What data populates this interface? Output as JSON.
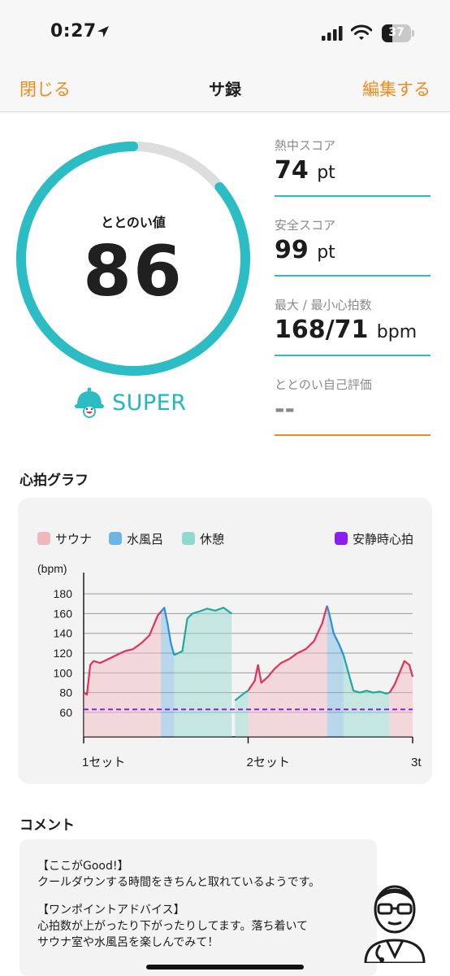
{
  "status_bar": {
    "time": "0:27",
    "battery_level": "37",
    "icons": [
      "location-arrow-icon",
      "cellular-signal-icon",
      "wifi-icon",
      "battery-icon"
    ]
  },
  "nav": {
    "close_label": "閉じる",
    "title": "サ録",
    "edit_label": "編集する",
    "accent_color": "#f08a1c"
  },
  "score": {
    "label": "ととのい値",
    "value": "86",
    "fraction": 0.86,
    "rank": "SUPER",
    "rank_icon": "sauna-hat-icon",
    "ring_color": "#2bbcc4"
  },
  "stats": [
    {
      "label": "熱中スコア",
      "value": "74",
      "unit": "pt"
    },
    {
      "label": "安全スコア",
      "value": "99",
      "unit": "pt"
    },
    {
      "label": "最大 / 最小心拍数",
      "value": "168/71",
      "unit": "bpm"
    },
    {
      "label": "ととのい自己評価",
      "value": "--",
      "unit": ""
    }
  ],
  "graph": {
    "section_title": "心拍グラフ",
    "legend": [
      {
        "label": "サウナ",
        "color": "#f0b8bc"
      },
      {
        "label": "水風呂",
        "color": "#6fb5e3"
      },
      {
        "label": "休憩",
        "color": "#8fd8cf"
      },
      {
        "label": "安静時心拍",
        "color": "#8a1ff0"
      }
    ]
  },
  "chart_data": {
    "type": "line",
    "ylabel": "(bpm)",
    "ylim": [
      50,
      190
    ],
    "y_ticks": [
      180,
      160,
      140,
      120,
      100,
      80,
      60
    ],
    "x_ticks": [
      "1セット",
      "2セット",
      "3t"
    ],
    "grid": true,
    "legend_position": "top",
    "resting_heart_rate": 63,
    "series": [
      {
        "name": "サウナ",
        "color": "#e0315e",
        "x": [
          0,
          0.02,
          0.04,
          0.06,
          0.1,
          0.15,
          0.2,
          0.25,
          0.3,
          0.35,
          0.4,
          0.45,
          0.47
        ],
        "y": [
          80,
          78,
          108,
          112,
          110,
          114,
          118,
          122,
          124,
          130,
          138,
          158,
          162
        ]
      },
      {
        "name": "水風呂",
        "color": "#2a8fd8",
        "x": [
          0.47,
          0.49,
          0.51,
          0.53,
          0.55
        ],
        "y": [
          162,
          166,
          150,
          130,
          118
        ]
      },
      {
        "name": "休憩",
        "color": "#22a89a",
        "x": [
          0.55,
          0.6,
          0.63,
          0.66,
          0.7,
          0.75,
          0.8,
          0.85,
          0.9
        ],
        "y": [
          118,
          122,
          155,
          160,
          162,
          165,
          163,
          166,
          160
        ]
      },
      {
        "name": "休憩",
        "color": "#22a89a",
        "x": [
          0.92,
          0.95,
          0.98,
          1.0
        ],
        "y": [
          72,
          76,
          80,
          82
        ]
      },
      {
        "name": "サウナ",
        "color": "#e0315e",
        "x": [
          1.0,
          1.04,
          1.06,
          1.08,
          1.12,
          1.16,
          1.2,
          1.25,
          1.3,
          1.35,
          1.4,
          1.45,
          1.48
        ],
        "y": [
          82,
          92,
          108,
          90,
          96,
          104,
          110,
          114,
          120,
          124,
          132,
          150,
          168
        ]
      },
      {
        "name": "水風呂",
        "color": "#2a8fd8",
        "x": [
          1.48,
          1.5,
          1.52,
          1.55,
          1.58
        ],
        "y": [
          168,
          155,
          140,
          130,
          118
        ]
      },
      {
        "name": "休憩",
        "color": "#22a89a",
        "x": [
          1.58,
          1.61,
          1.64,
          1.68,
          1.72,
          1.76,
          1.8,
          1.84,
          1.86
        ],
        "y": [
          118,
          100,
          82,
          80,
          82,
          80,
          81,
          79,
          80
        ]
      },
      {
        "name": "サウナ",
        "color": "#e0315e",
        "x": [
          1.86,
          1.89,
          1.92,
          1.95,
          1.98,
          2.0
        ],
        "y": [
          80,
          88,
          100,
          112,
          108,
          96
        ]
      }
    ]
  },
  "comment": {
    "section_title": "コメント",
    "lines": [
      "【ここがGood!】",
      "クールダウンする時間をきちんと取れているようです。",
      "",
      "【ワンポイントアドバイス】",
      "心拍数が上がったり下がったりしてます。落ち着いて",
      "サウナ室や水風呂を楽しんでみて！"
    ],
    "avatar_icon": "doctor-avatar-icon"
  }
}
